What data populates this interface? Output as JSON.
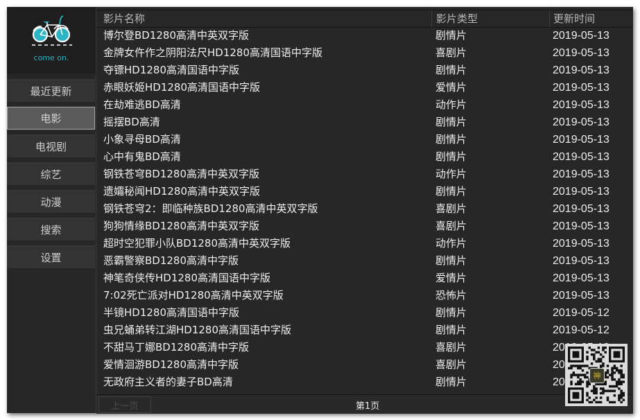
{
  "app": {
    "logo_icon": "bicycle-icon",
    "tagline": "come on.",
    "accent_color": "#2bb5c4"
  },
  "sidebar": {
    "items": [
      {
        "label": "最近更新",
        "active": false
      },
      {
        "label": "电影",
        "active": true
      },
      {
        "label": "电视剧",
        "active": false
      },
      {
        "label": "综艺",
        "active": false
      },
      {
        "label": "动漫",
        "active": false
      },
      {
        "label": "搜索",
        "active": false
      },
      {
        "label": "设置",
        "active": false
      }
    ]
  },
  "table": {
    "columns": [
      "影片名称",
      "影片类型",
      "更新时间"
    ],
    "rows": [
      {
        "name": "博尔登BD1280高清中英双字版",
        "type": "剧情片",
        "date": "2019-05-13"
      },
      {
        "name": "金牌女仵作之阴阳法尺HD1280高清国语中字版",
        "type": "喜剧片",
        "date": "2019-05-13"
      },
      {
        "name": "夺镖HD1280高清国语中字版",
        "type": "剧情片",
        "date": "2019-05-13"
      },
      {
        "name": "赤眼妖姬HD1280高清国语中字版",
        "type": "爱情片",
        "date": "2019-05-13"
      },
      {
        "name": "在劫难逃BD高清",
        "type": "动作片",
        "date": "2019-05-13"
      },
      {
        "name": "摇摆BD高清",
        "type": "剧情片",
        "date": "2019-05-13"
      },
      {
        "name": "小象寻母BD高清",
        "type": "剧情片",
        "date": "2019-05-13"
      },
      {
        "name": "心中有鬼BD高清",
        "type": "剧情片",
        "date": "2019-05-13"
      },
      {
        "name": "钢铁苍穹BD1280高清中英双字版",
        "type": "动作片",
        "date": "2019-05-13"
      },
      {
        "name": "遗孀秘闻HD1280高清中英双字版",
        "type": "剧情片",
        "date": "2019-05-13"
      },
      {
        "name": "钢铁苍穹2：即临种族BD1280高清中英双字版",
        "type": "喜剧片",
        "date": "2019-05-13"
      },
      {
        "name": "狗狗情缘BD1280高清中英双字版",
        "type": "喜剧片",
        "date": "2019-05-13"
      },
      {
        "name": "超时空犯罪小队BD1280高清中英双字版",
        "type": "动作片",
        "date": "2019-05-13"
      },
      {
        "name": "恶霸警察BD1280高清中字版",
        "type": "剧情片",
        "date": "2019-05-13"
      },
      {
        "name": "神笔奇侠传HD1280高清国语中字版",
        "type": "爱情片",
        "date": "2019-05-13"
      },
      {
        "name": "7:02死亡派对HD1280高清中英双字版",
        "type": "恐怖片",
        "date": "2019-05-13"
      },
      {
        "name": "半镜HD1280高清国语中字版",
        "type": "剧情片",
        "date": "2019-05-12"
      },
      {
        "name": "虫兄蛹弟转江湖HD1280高清国语中字版",
        "type": "剧情片",
        "date": "2019-05-12"
      },
      {
        "name": "不甜马丁娜BD1280高清中字版",
        "type": "喜剧片",
        "date": "2019-05-12"
      },
      {
        "name": "爱情洄游BD1280高清中字版",
        "type": "喜剧片",
        "date": "2019-05-12"
      },
      {
        "name": "无政府主义者的妻子BD高清",
        "type": "剧情片",
        "date": "2019-05-12"
      }
    ]
  },
  "pager": {
    "prev_label": "上一页",
    "prev_enabled": false,
    "page_label": "第1页"
  },
  "overlay": {
    "qr_icon": "qr-code-icon",
    "qr_center_label": "神"
  }
}
